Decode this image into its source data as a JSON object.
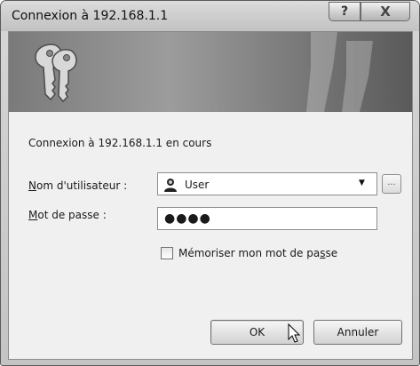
{
  "window": {
    "title": "Connexion à 192.168.1.1",
    "help_glyph": "?",
    "close_glyph": "X"
  },
  "banner": {
    "icon": "keys-icon"
  },
  "status": "Connexion à 192.168.1.1 en cours",
  "form": {
    "username_label_accel": "N",
    "username_label_rest": "om d'utilisateur :",
    "username_value": "User",
    "username_icon": "user-icon",
    "browse_label": "...",
    "password_label_accel": "M",
    "password_label_rest": "ot de passe :",
    "password_value": "●●●●",
    "remember_label_before": "Mémoriser mon mot de pa",
    "remember_label_accel": "s",
    "remember_label_after": "se",
    "remember_checked": false
  },
  "buttons": {
    "ok": "OK",
    "cancel": "Annuler"
  }
}
